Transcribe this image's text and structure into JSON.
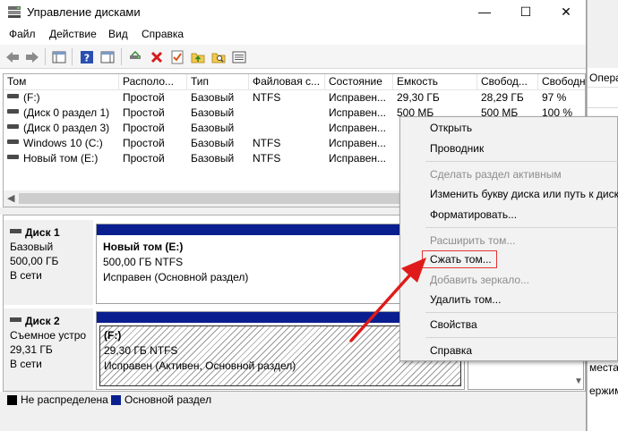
{
  "window": {
    "title": "Управление дисками",
    "controls": {
      "minimize": "—",
      "maximize": "☐",
      "close": "✕"
    }
  },
  "menu": [
    "Файл",
    "Действие",
    "Вид",
    "Справка"
  ],
  "table": {
    "columns": [
      "Том",
      "Располо...",
      "Тип",
      "Файловая с...",
      "Состояние",
      "Емкость",
      "Свобод...",
      "Свободн"
    ],
    "rows": [
      [
        "(F:)",
        "Простой",
        "Базовый",
        "NTFS",
        "Исправен...",
        "29,30 ГБ",
        "28,29 ГБ",
        "97 %"
      ],
      [
        "(Диск 0 раздел 1)",
        "Простой",
        "Базовый",
        "",
        "Исправен...",
        "500 МБ",
        "500 МБ",
        "100 %"
      ],
      [
        "(Диск 0 раздел 3)",
        "Простой",
        "Базовый",
        "",
        "Исправен...",
        "",
        "",
        ""
      ],
      [
        "Windows 10 (C:)",
        "Простой",
        "Базовый",
        "NTFS",
        "Исправен...",
        "",
        "",
        ""
      ],
      [
        "Новый том (E:)",
        "Простой",
        "Базовый",
        "NTFS",
        "Исправен...",
        "",
        "",
        ""
      ]
    ]
  },
  "disks": [
    {
      "name": "Диск 1",
      "type": "Базовый",
      "size": "500,00 ГБ",
      "status": "В сети",
      "partition": {
        "title": "Новый том  (E:)",
        "size": "500,00 ГБ NTFS",
        "status": "Исправен (Основной раздел)"
      }
    },
    {
      "name": "Диск 2",
      "type": "Съемное устро",
      "size": "29,31 ГБ",
      "status": "В сети",
      "partition": {
        "title": "(F:)",
        "size": "29,30 ГБ NTFS",
        "status": "Исправен (Активен, Основной раздел)"
      }
    }
  ],
  "legend": [
    {
      "label": "Не распределена",
      "color": "#000000"
    },
    {
      "label": "Основной раздел",
      "color": "#0a1f8f"
    }
  ],
  "context_menu": {
    "items": [
      {
        "label": "Открыть",
        "disabled": false
      },
      {
        "label": "Проводник",
        "disabled": false
      },
      {
        "label": "Сделать раздел активным",
        "disabled": true
      },
      {
        "label": "Изменить букву диска или путь к диску...",
        "disabled": false
      },
      {
        "label": "Форматировать...",
        "disabled": false
      },
      {
        "label": "Расширить том...",
        "disabled": true
      },
      {
        "label": "Сжать том...",
        "disabled": false,
        "highlighted": true
      },
      {
        "label": "Добавить зеркало...",
        "disabled": true
      },
      {
        "label": "Удалить том...",
        "disabled": false
      },
      {
        "label": "Свойства",
        "disabled": false
      },
      {
        "label": "Справка",
        "disabled": false
      }
    ]
  },
  "background_window": {
    "header": "Операции",
    "text1": "места",
    "text2": "ержим"
  },
  "colors": {
    "primary_partition": "#0a1f8f",
    "highlight_box": "#e53333",
    "arrow": "#e01a1a"
  }
}
